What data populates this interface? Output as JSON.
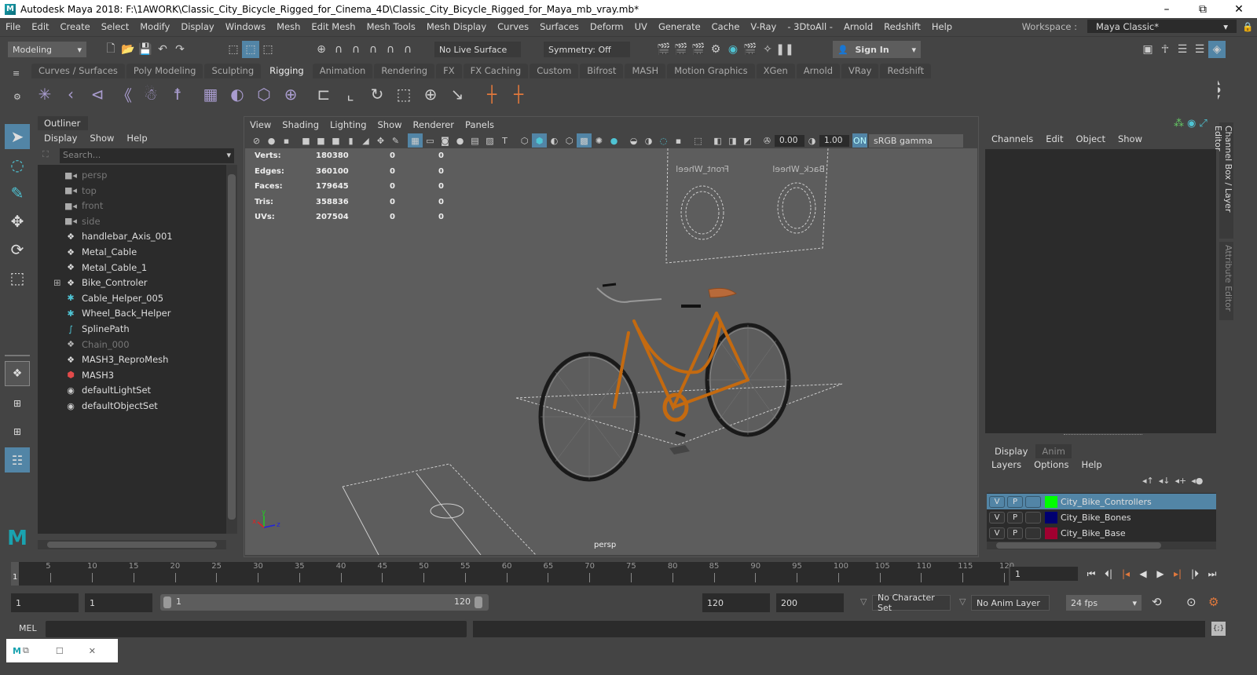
{
  "window": {
    "title": "Autodesk Maya 2018: F:\\1AWORK\\Classic_City_Bicycle_Rigged_for_Cinema_4D\\Classic_City_Bicycle_Rigged_for_Maya_mb_vray.mb*",
    "minimize": "–",
    "maximize": "⧉",
    "close": "✕"
  },
  "menubar": {
    "items": [
      "File",
      "Edit",
      "Create",
      "Select",
      "Modify",
      "Display",
      "Windows",
      "Mesh",
      "Edit Mesh",
      "Mesh Tools",
      "Mesh Display",
      "Curves",
      "Surfaces",
      "Deform",
      "UV",
      "Generate",
      "Cache",
      "V-Ray",
      "- 3DtoAll -",
      "Arnold",
      "Redshift",
      "Help"
    ],
    "workspace_label": "Workspace :",
    "workspace_value": "Maya Classic*"
  },
  "statusline": {
    "mode": "Modeling",
    "live_surface": "No Live Surface",
    "symmetry": "Symmetry: Off",
    "sign_in": "Sign In"
  },
  "shelf": {
    "tabs": [
      "Curves / Surfaces",
      "Poly Modeling",
      "Sculpting",
      "Rigging",
      "Animation",
      "Rendering",
      "FX",
      "FX Caching",
      "Custom",
      "Bifrost",
      "MASH",
      "Motion Graphics",
      "XGen",
      "Arnold",
      "VRay",
      "Redshift"
    ],
    "active_tab": "Rigging"
  },
  "outliner": {
    "title": "Outliner",
    "menu": [
      "Display",
      "Show",
      "Help"
    ],
    "search_placeholder": "Search...",
    "items": [
      {
        "label": "persp",
        "icon": "camera-icon",
        "dim": true
      },
      {
        "label": "top",
        "icon": "camera-icon",
        "dim": true
      },
      {
        "label": "front",
        "icon": "camera-icon",
        "dim": true
      },
      {
        "label": "side",
        "icon": "camera-icon",
        "dim": true
      },
      {
        "label": "handlebar_Axis_001",
        "icon": "transform-icon",
        "dim": false
      },
      {
        "label": "Metal_Cable",
        "icon": "transform-icon",
        "dim": false
      },
      {
        "label": "Metal_Cable_1",
        "icon": "transform-icon",
        "dim": false
      },
      {
        "label": "Bike_Controler",
        "icon": "transform-icon",
        "dim": false,
        "expandable": true
      },
      {
        "label": "Cable_Helper_005",
        "icon": "locator-icon",
        "dim": false
      },
      {
        "label": "Wheel_Back_Helper",
        "icon": "locator-icon",
        "dim": false
      },
      {
        "label": "SplinePath",
        "icon": "curve-icon",
        "dim": false
      },
      {
        "label": "Chain_000",
        "icon": "transform-icon",
        "dim": true
      },
      {
        "label": "MASH3_ReproMesh",
        "icon": "transform-icon",
        "dim": false
      },
      {
        "label": "MASH3",
        "icon": "mash-icon",
        "dim": false
      },
      {
        "label": "defaultLightSet",
        "icon": "set-icon",
        "dim": false
      },
      {
        "label": "defaultObjectSet",
        "icon": "set-icon",
        "dim": false
      }
    ]
  },
  "viewport": {
    "menu": [
      "View",
      "Shading",
      "Lighting",
      "Show",
      "Renderer",
      "Panels"
    ],
    "exposure": "0.00",
    "gamma": "1.00",
    "color_space": "sRGB gamma",
    "camera_label": "persp",
    "hud": [
      {
        "label": "Verts:",
        "value": "180380",
        "sel": "0",
        "comp": "0"
      },
      {
        "label": "Edges:",
        "value": "360100",
        "sel": "0",
        "comp": "0"
      },
      {
        "label": "Faces:",
        "value": "179645",
        "sel": "0",
        "comp": "0"
      },
      {
        "label": "Tris:",
        "value": "358836",
        "sel": "0",
        "comp": "0"
      },
      {
        "label": "UVs:",
        "value": "207504",
        "sel": "0",
        "comp": "0"
      }
    ],
    "scene_labels": {
      "front_wheel": "Front_Wheel",
      "back_wheel": "Back_Wheel"
    },
    "axis": {
      "x": "x",
      "y": "y",
      "z": "z"
    }
  },
  "channel_box": {
    "menu": [
      "Channels",
      "Edit",
      "Object",
      "Show"
    ],
    "side_tabs": [
      "Channel Box / Layer Editor",
      "Attribute Editor"
    ]
  },
  "layer_editor": {
    "tabs": [
      "Display",
      "Anim"
    ],
    "active_tab": "Display",
    "menu": [
      "Layers",
      "Options",
      "Help"
    ],
    "layers": [
      {
        "v": "V",
        "p": "P",
        "name": "City_Bike_Controllers",
        "color": "#00ff00",
        "selected": true
      },
      {
        "v": "V",
        "p": "P",
        "name": "City_Bike_Bones",
        "color": "#000070",
        "selected": false
      },
      {
        "v": "V",
        "p": "P",
        "name": "City_Bike_Base",
        "color": "#a00030",
        "selected": false
      }
    ]
  },
  "timeline": {
    "ticks": [
      5,
      10,
      15,
      20,
      25,
      30,
      35,
      40,
      45,
      50,
      55,
      60,
      65,
      70,
      75,
      80,
      85,
      90,
      95,
      100,
      105,
      110,
      115,
      120
    ],
    "start": 1,
    "end": 120,
    "current_frame": "1",
    "current_frame_field": "1"
  },
  "range": {
    "start_field": "1",
    "playback_start": "1",
    "slider_start": "1",
    "slider_end": "120",
    "playback_end": "120",
    "end_field": "200",
    "character_set": "No Character Set",
    "anim_layer": "No Anim Layer",
    "fps": "24 fps"
  },
  "commandline": {
    "label": "MEL"
  },
  "accent": "#5285a6"
}
